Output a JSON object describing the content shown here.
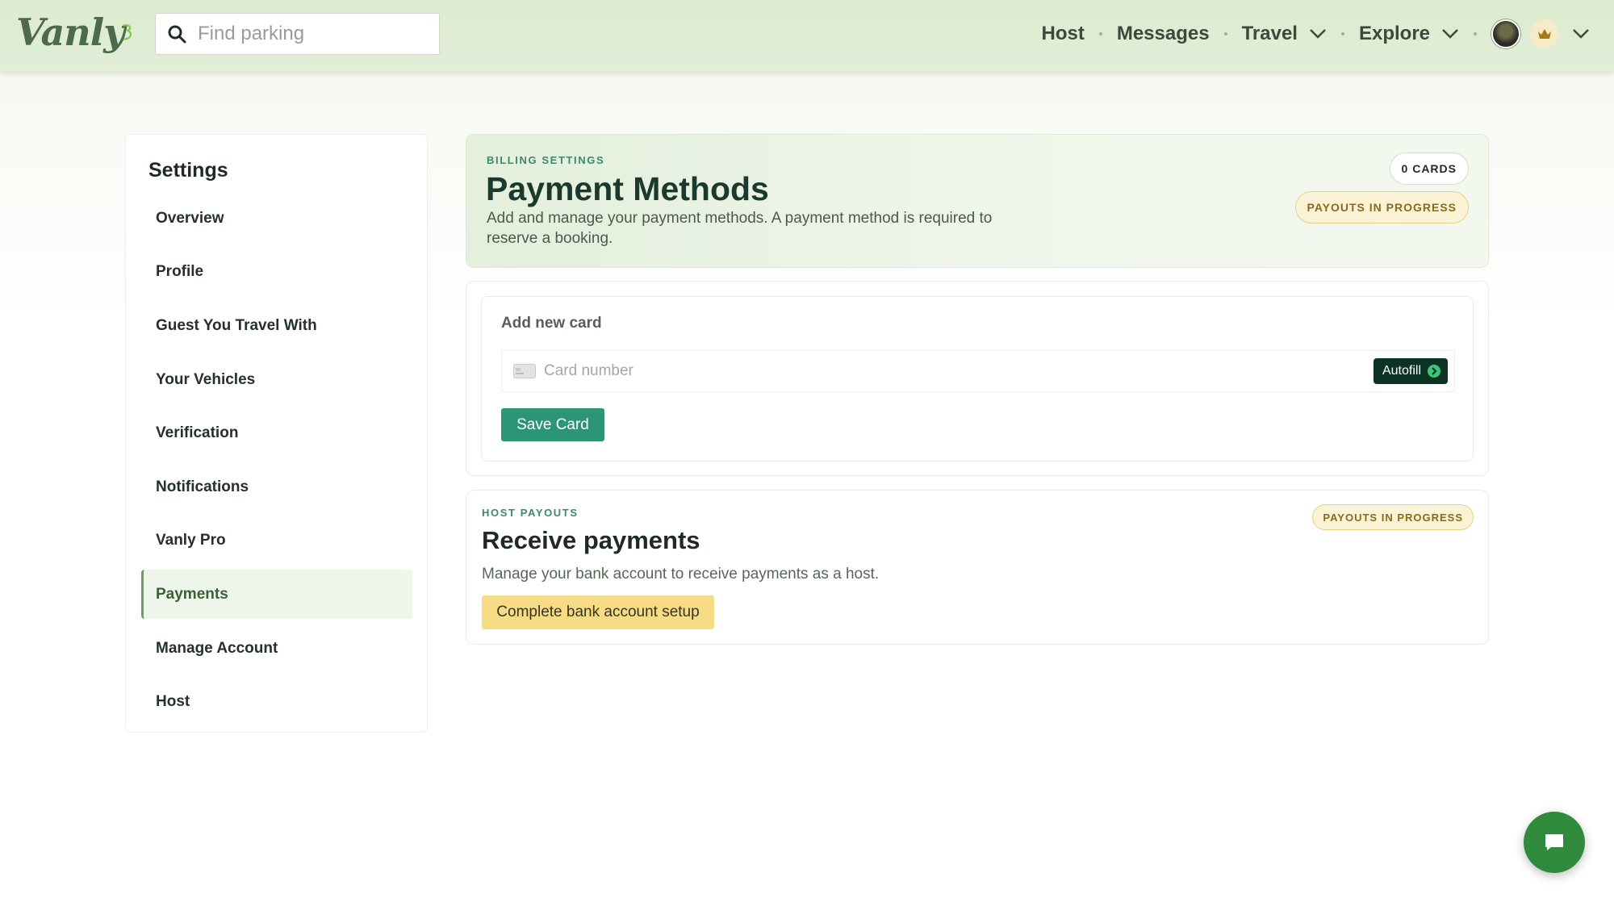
{
  "brand": {
    "name": "Vanly"
  },
  "search": {
    "placeholder": "Find parking"
  },
  "nav": {
    "host": "Host",
    "messages": "Messages",
    "travel": "Travel",
    "explore": "Explore"
  },
  "sidebar": {
    "title": "Settings",
    "items": [
      {
        "label": "Overview"
      },
      {
        "label": "Profile"
      },
      {
        "label": "Guest You Travel With"
      },
      {
        "label": "Your Vehicles"
      },
      {
        "label": "Verification"
      },
      {
        "label": "Notifications"
      },
      {
        "label": "Vanly Pro"
      },
      {
        "label": "Payments",
        "active": true
      },
      {
        "label": "Manage Account"
      },
      {
        "label": "Host"
      }
    ]
  },
  "billing": {
    "eyebrow": "BILLING SETTINGS",
    "title": "Payment Methods",
    "description": "Add and manage your payment methods. A payment method is required to reserve a booking.",
    "cards_badge": "0 CARDS",
    "payout_badge": "PAYOUTS IN PROGRESS"
  },
  "add_card": {
    "title": "Add new card",
    "card_placeholder": "Card number",
    "autofill_label": "Autofill",
    "save_label": "Save Card"
  },
  "payouts": {
    "eyebrow": "HOST PAYOUTS",
    "title": "Receive payments",
    "description": "Manage your bank account to receive payments as a host.",
    "badge": "PAYOUTS IN PROGRESS",
    "button_label": "Complete bank account setup"
  },
  "colors": {
    "accent_green": "#2c9477",
    "dark_green": "#0b3323",
    "payout_yellow": "#f7dc86",
    "chat_green": "#2f8a3c"
  },
  "icons": {
    "search": "search-icon",
    "chevron": "chevron-down-icon",
    "crown": "crown-icon",
    "card": "credit-card-icon",
    "autofill_arrow": "arrow-right-circle-icon",
    "chat": "chat-icon"
  }
}
